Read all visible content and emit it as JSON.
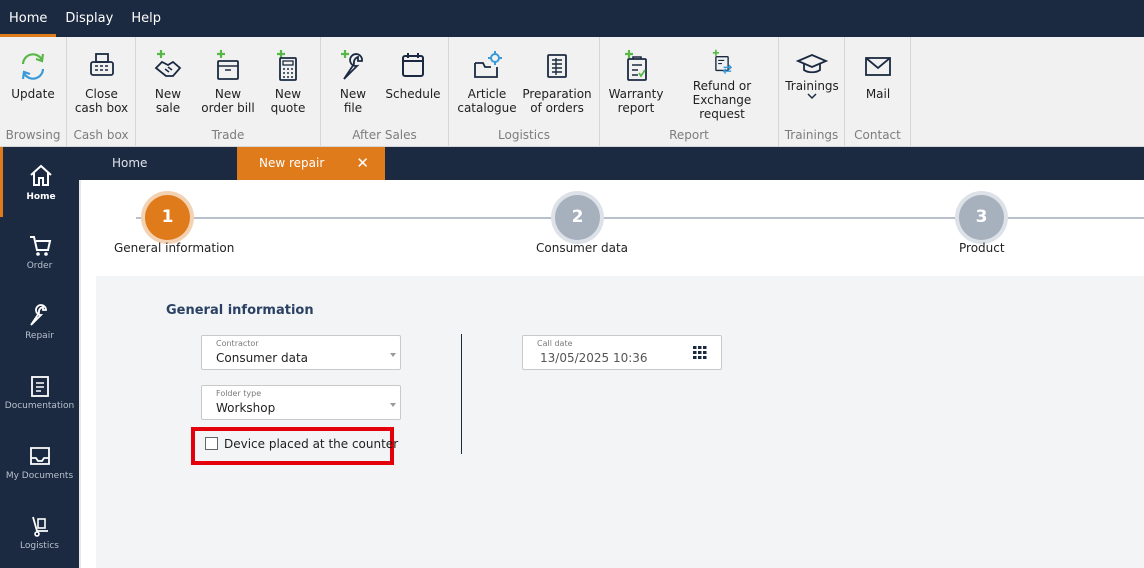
{
  "menu": {
    "home": "Home",
    "display": "Display",
    "help": "Help"
  },
  "ribbon": {
    "browsing": {
      "update": "Update",
      "group": "Browsing"
    },
    "cash_box": {
      "close": "Close\ncash box",
      "group": "Cash box"
    },
    "trade": {
      "new_sale": "New\nsale",
      "new_order_bill": "New\norder bill",
      "new_quote": "New\nquote",
      "group": "Trade"
    },
    "after_sales": {
      "new_file": "New\nfile",
      "schedule": "Schedule",
      "group": "After Sales"
    },
    "logistics": {
      "article": "Article\ncatalogue",
      "prep": "Preparation\nof orders",
      "group": "Logistics"
    },
    "report": {
      "warranty": "Warranty\nreport",
      "refund": "Refund or\nExchange request",
      "group": "Report"
    },
    "trainings": {
      "btn": "Trainings",
      "group": "Trainings"
    },
    "contact": {
      "mail": "Mail",
      "group": "Contact"
    }
  },
  "sidebar": [
    {
      "label": "Home",
      "icon": "home-icon"
    },
    {
      "label": "Order",
      "icon": "cart-icon"
    },
    {
      "label": "Repair",
      "icon": "wrench-icon"
    },
    {
      "label": "Documentation",
      "icon": "document-icon"
    },
    {
      "label": "My Documents",
      "icon": "inbox-icon"
    },
    {
      "label": "Logistics",
      "icon": "hand-truck-icon"
    }
  ],
  "tabs": {
    "home": "Home",
    "new_repair": "New repair",
    "close": "✕"
  },
  "steps": [
    {
      "num": "1",
      "label": "General information"
    },
    {
      "num": "2",
      "label": "Consumer data"
    },
    {
      "num": "3",
      "label": "Product"
    }
  ],
  "form": {
    "section_title": "General information",
    "contractor": {
      "label": "Contractor",
      "value": "Consumer data"
    },
    "folder_type": {
      "label": "Folder type",
      "value": "Workshop"
    },
    "call_date": {
      "label": "Call date",
      "value": "13/05/2025 10:36"
    },
    "device_counter": {
      "label": "Device placed at the counter",
      "checked": false
    }
  },
  "colors": {
    "accent": "#e07b1c",
    "navy": "#1b2a41",
    "highlight": "#e3000b",
    "step_inactive": "#a7b1bd"
  }
}
